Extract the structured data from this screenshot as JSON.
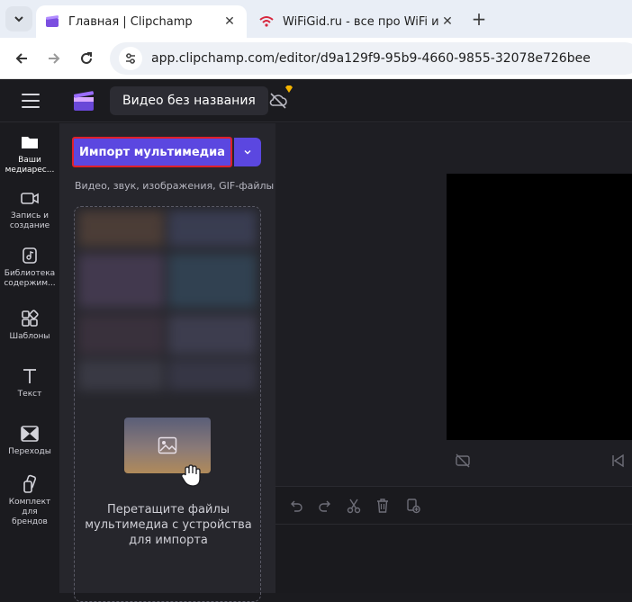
{
  "browser": {
    "tabs": [
      {
        "title": "Главная | Clipchamp",
        "active": true
      },
      {
        "title": "WiFiGid.ru - все про WiFi и бес",
        "active": false
      }
    ],
    "url": "app.clipchamp.com/editor/d9a129f9-95b9-4660-9855-32078e726bee"
  },
  "app": {
    "project_title": "Видео без названия",
    "accent_color": "#5b47e0",
    "highlight_color": "#e0202a"
  },
  "leftnav": {
    "items": [
      {
        "label": "Ваши медиарес...",
        "icon": "folder-icon",
        "active": true
      },
      {
        "label": "Запись и создание",
        "icon": "video-camera-icon",
        "active": false
      },
      {
        "label": "Библиотека содержим...",
        "icon": "content-library-icon",
        "active": false
      },
      {
        "label": "Шаблоны",
        "icon": "templates-icon",
        "active": false
      },
      {
        "label": "Текст",
        "icon": "text-icon",
        "active": false
      },
      {
        "label": "Переходы",
        "icon": "transitions-icon",
        "active": false
      },
      {
        "label": "Комплект для брендов",
        "icon": "brand-kit-icon",
        "active": false
      }
    ]
  },
  "media_panel": {
    "import_label": "Импорт мультимедиа",
    "file_types": "Видео, звук, изображения, GIF-файлы",
    "drop_text": "Перетащите файлы мультимедиа с устройства для импорта"
  }
}
